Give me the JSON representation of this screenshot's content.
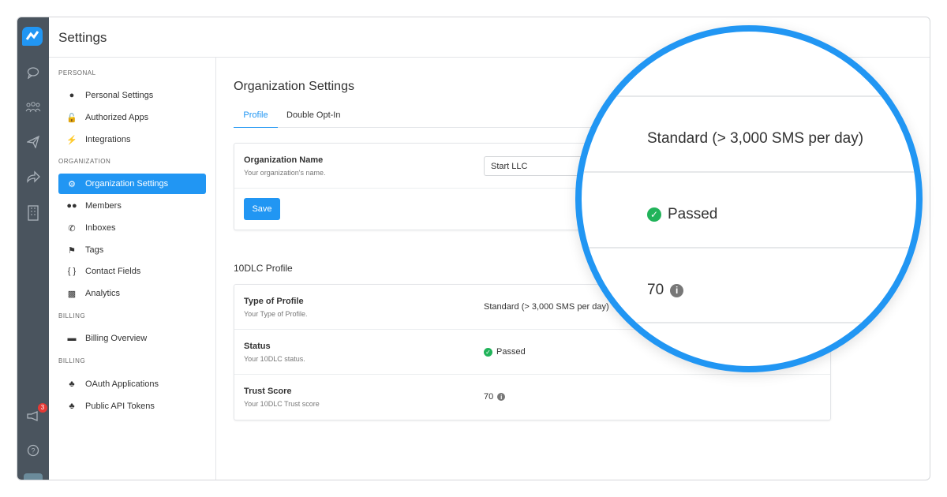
{
  "app": {
    "title": "Settings",
    "notification_count": "3"
  },
  "nav": {
    "sections": [
      {
        "label": "PERSONAL",
        "items": [
          {
            "label": "Personal Settings",
            "icon": "user-icon"
          },
          {
            "label": "Authorized Apps",
            "icon": "unlock-icon"
          },
          {
            "label": "Integrations",
            "icon": "plug-icon"
          }
        ]
      },
      {
        "label": "ORGANIZATION",
        "items": [
          {
            "label": "Organization Settings",
            "icon": "gear-icon",
            "active": true
          },
          {
            "label": "Members",
            "icon": "users-icon"
          },
          {
            "label": "Inboxes",
            "icon": "phone-icon"
          },
          {
            "label": "Tags",
            "icon": "tags-icon"
          },
          {
            "label": "Contact Fields",
            "icon": "braces-icon"
          },
          {
            "label": "Analytics",
            "icon": "chart-icon"
          }
        ]
      },
      {
        "label": "BILLING",
        "items": [
          {
            "label": "Billing Overview",
            "icon": "credit-card-icon"
          }
        ]
      },
      {
        "label": "BILLING",
        "items": [
          {
            "label": "OAuth Applications",
            "icon": "cubes-icon"
          },
          {
            "label": "Public API Tokens",
            "icon": "cubes-icon"
          }
        ]
      }
    ]
  },
  "main": {
    "title": "Organization Settings",
    "tabs": [
      {
        "label": "Profile",
        "active": true
      },
      {
        "label": "Double Opt-In"
      }
    ],
    "org_name": {
      "label": "Organization Name",
      "sub": "Your organization's name.",
      "value": "Start LLC"
    },
    "save_label": "Save",
    "section_title": "10DLC Profile",
    "profile_type": {
      "label": "Type of Profile",
      "sub": "Your Type of Profile.",
      "value": "Standard (> 3,000 SMS per day)"
    },
    "status": {
      "label": "Status",
      "sub": "Your 10DLC status.",
      "value": "Passed"
    },
    "trust": {
      "label": "Trust Score",
      "sub": "Your 10DLC Trust score",
      "value": "70"
    }
  },
  "colors": {
    "accent": "#2196f3",
    "success": "#21b35a",
    "rail": "#4a545e"
  }
}
